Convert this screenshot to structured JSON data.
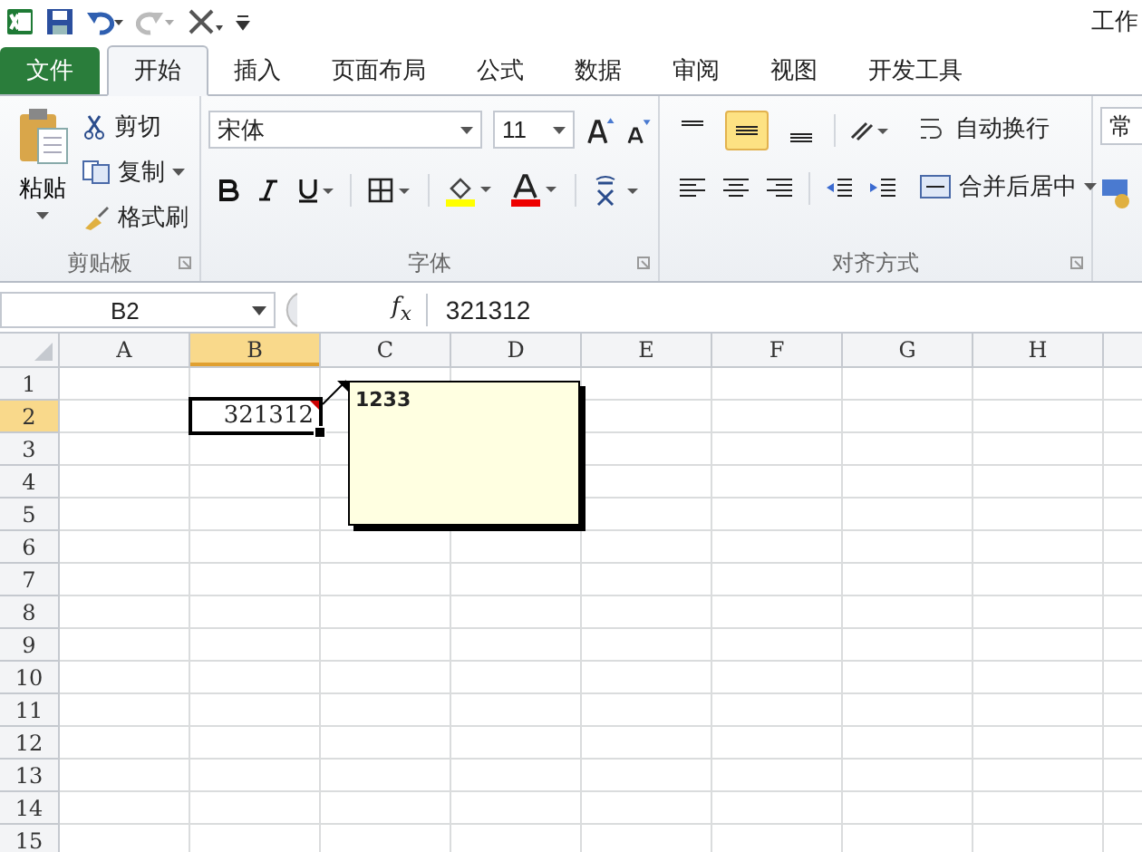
{
  "window": {
    "title": "工作"
  },
  "tabs": [
    {
      "label": "文件",
      "kind": "file",
      "selected": false
    },
    {
      "label": "开始",
      "kind": "tab",
      "selected": true
    },
    {
      "label": "插入",
      "kind": "tab",
      "selected": false
    },
    {
      "label": "页面布局",
      "kind": "tab",
      "selected": false
    },
    {
      "label": "公式",
      "kind": "tab",
      "selected": false
    },
    {
      "label": "数据",
      "kind": "tab",
      "selected": false
    },
    {
      "label": "审阅",
      "kind": "tab",
      "selected": false
    },
    {
      "label": "视图",
      "kind": "tab",
      "selected": false
    },
    {
      "label": "开发工具",
      "kind": "tab",
      "selected": false
    }
  ],
  "clipboard": {
    "title": "剪贴板",
    "paste": "粘贴",
    "cut": "剪切",
    "copy": "复制",
    "format_painter": "格式刷"
  },
  "font": {
    "title": "字体",
    "name": "宋体",
    "size": "11"
  },
  "alignment": {
    "title": "对齐方式",
    "vertical": [
      {
        "selected": false
      },
      {
        "selected": true
      },
      {
        "selected": false
      }
    ],
    "wrap_text": "自动换行",
    "merge_center": "合并后居中"
  },
  "number": {
    "format": "常"
  },
  "formula_bar": {
    "name_box": "B2",
    "insert_function": "f$_{x}$",
    "value": "321312"
  },
  "sheet": {
    "columns": [
      {
        "label": "A",
        "selected": false
      },
      {
        "label": "B",
        "selected": true
      },
      {
        "label": "C",
        "selected": false
      },
      {
        "label": "D",
        "selected": false
      },
      {
        "label": "E",
        "selected": false
      },
      {
        "label": "F",
        "selected": false
      },
      {
        "label": "G",
        "selected": false
      },
      {
        "label": "H",
        "selected": false
      }
    ],
    "rows": [
      {
        "label": "1",
        "selected": false
      },
      {
        "label": "2",
        "selected": true
      },
      {
        "label": "3",
        "selected": false
      },
      {
        "label": "4",
        "selected": false
      },
      {
        "label": "5",
        "selected": false
      },
      {
        "label": "6",
        "selected": false
      },
      {
        "label": "7",
        "selected": false
      },
      {
        "label": "8",
        "selected": false
      },
      {
        "label": "9",
        "selected": false
      },
      {
        "label": "10",
        "selected": false
      },
      {
        "label": "11",
        "selected": false
      },
      {
        "label": "12",
        "selected": false
      },
      {
        "label": "13",
        "selected": false
      },
      {
        "label": "14",
        "selected": false
      },
      {
        "label": "15",
        "selected": false
      }
    ],
    "active_cell": {
      "value": "321312"
    },
    "comment": {
      "text": "1233"
    }
  }
}
